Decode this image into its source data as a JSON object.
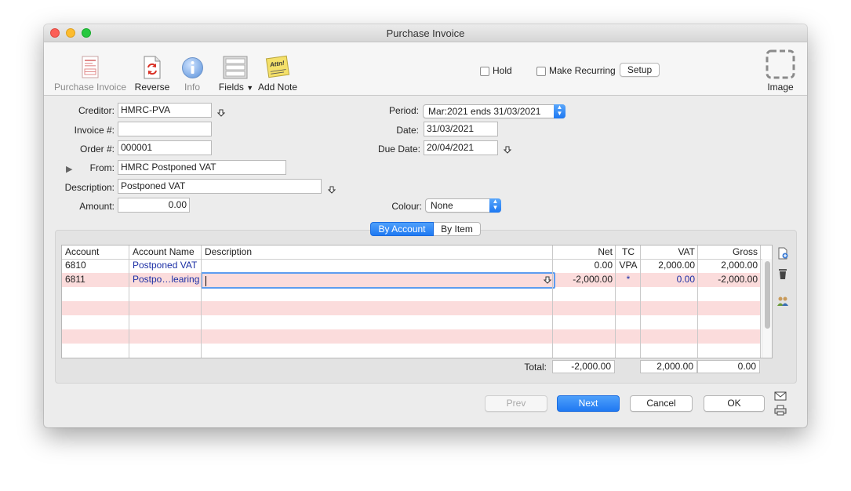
{
  "window": {
    "title": "Purchase Invoice"
  },
  "toolbar": {
    "purchase_invoice": "Purchase Invoice",
    "reverse": "Reverse",
    "info": "Info",
    "fields": "Fields",
    "add_note": "Add Note",
    "note_sticker": "Attn!",
    "hold": "Hold",
    "make_recurring": "Make Recurring",
    "setup": "Setup",
    "image": "Image"
  },
  "form": {
    "creditor_label": "Creditor:",
    "creditor_value": "HMRC-PVA",
    "invoice_label": "Invoice #:",
    "invoice_value": "",
    "order_label": "Order #:",
    "order_value": "000001",
    "from_label": "From:",
    "from_value": "HMRC Postponed VAT",
    "description_label": "Description:",
    "description_value": "Postponed VAT",
    "amount_label": "Amount:",
    "amount_value": "0.00",
    "period_label": "Period:",
    "period_value": "Mar:2021 ends 31/03/2021",
    "date_label": "Date:",
    "date_value": "31/03/2021",
    "due_date_label": "Due Date:",
    "due_date_value": "20/04/2021",
    "colour_label": "Colour:",
    "colour_value": "None"
  },
  "tabs": {
    "by_account": "By Account",
    "by_item": "By Item"
  },
  "table": {
    "headers": {
      "account": "Account",
      "account_name": "Account Name",
      "description": "Description",
      "net": "Net",
      "tc": "TC",
      "vat": "VAT",
      "gross": "Gross"
    },
    "rows": [
      {
        "account": "6810",
        "account_name": "Postponed VAT",
        "description": "",
        "net": "0.00",
        "tc": "VPA",
        "vat": "2,000.00",
        "gross": "2,000.00"
      },
      {
        "account": "6811",
        "account_name": "Postpo…learing",
        "description": "",
        "net": "-2,000.00",
        "tc": "*",
        "vat": "0.00",
        "gross": "-2,000.00"
      }
    ],
    "total_label": "Total:",
    "total_net": "-2,000.00",
    "total_vat": "2,000.00",
    "total_gross": "0.00"
  },
  "buttons": {
    "prev": "Prev",
    "next": "Next",
    "cancel": "Cancel",
    "ok": "OK"
  },
  "colors": {
    "accent": "#1f79f2",
    "row_pink": "#fbdcdc",
    "link_blue": "#1c2fa5"
  }
}
